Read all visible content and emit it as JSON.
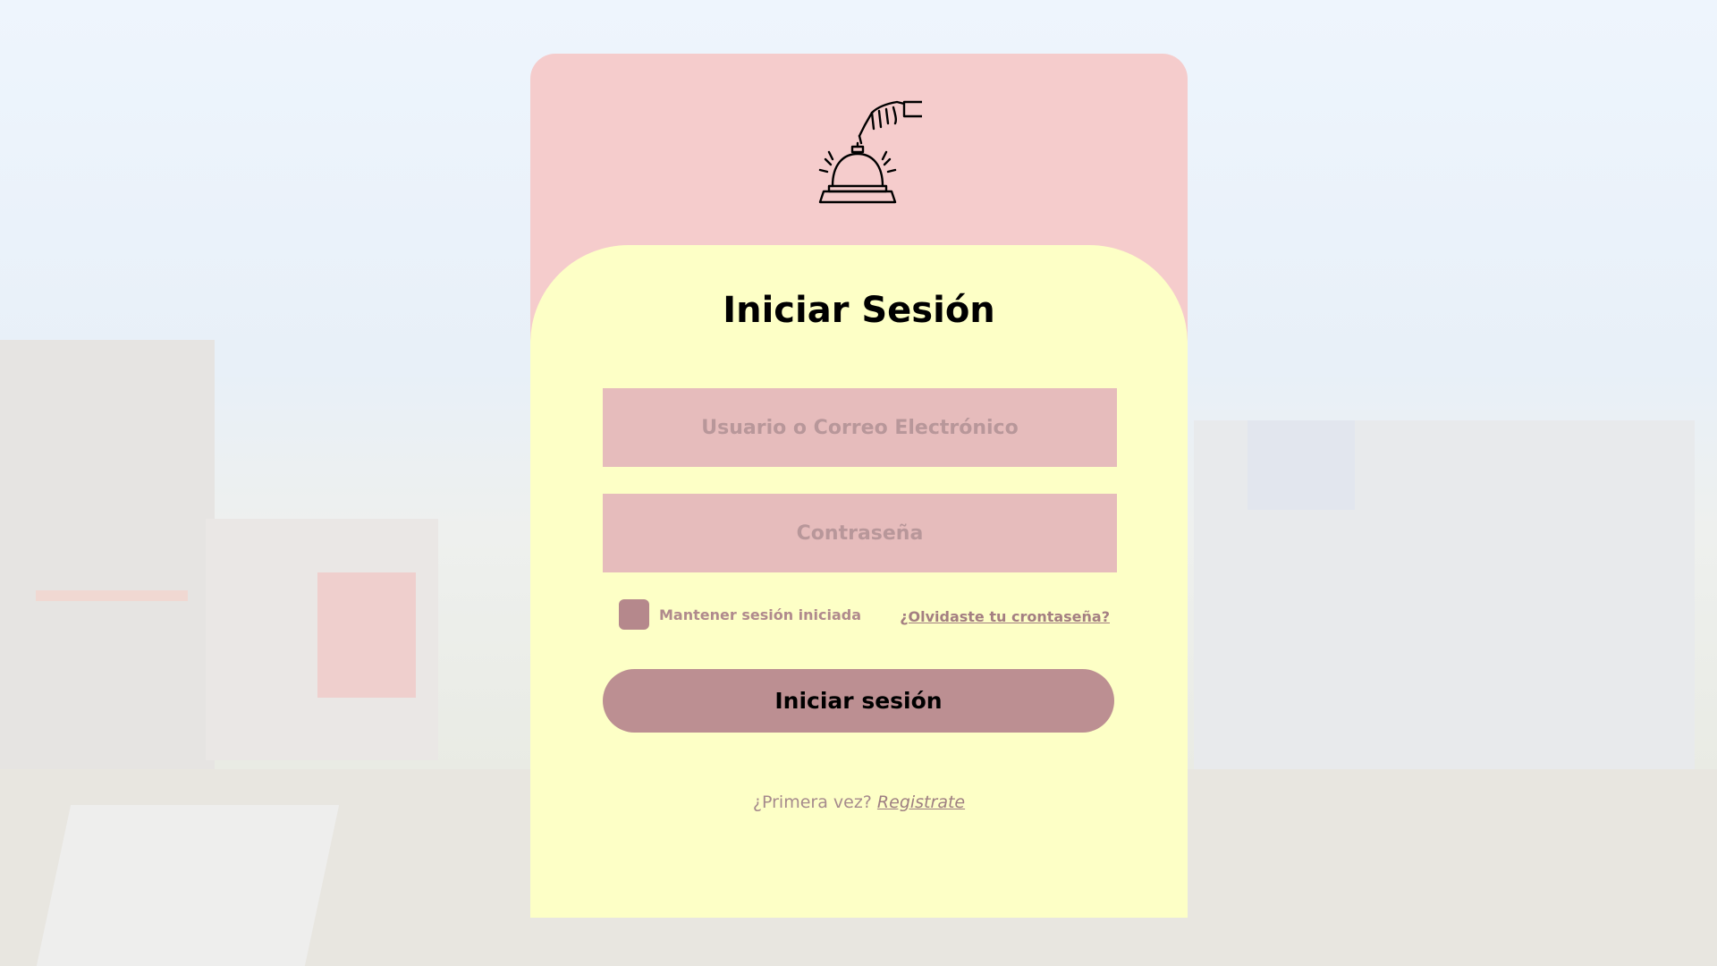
{
  "colors": {
    "card_top": "#f5cccc",
    "panel": "#fdffc6",
    "input_bg": "#e6bcbc",
    "button_bg": "#bc8f92",
    "muted_text": "#b08a8d"
  },
  "logo": {
    "icon": "service-bell-icon"
  },
  "login": {
    "title": "Iniciar Sesión",
    "username_placeholder": "Usuario o Correo Electrónico",
    "password_placeholder": "Contraseña",
    "remember_label": "Mantener sesión iniciada",
    "forgot_link": "¿Olvidaste tu crontaseña?",
    "submit_label": "Iniciar sesión",
    "signup_prompt": "¿Primera vez?",
    "signup_link": "Registrate"
  }
}
